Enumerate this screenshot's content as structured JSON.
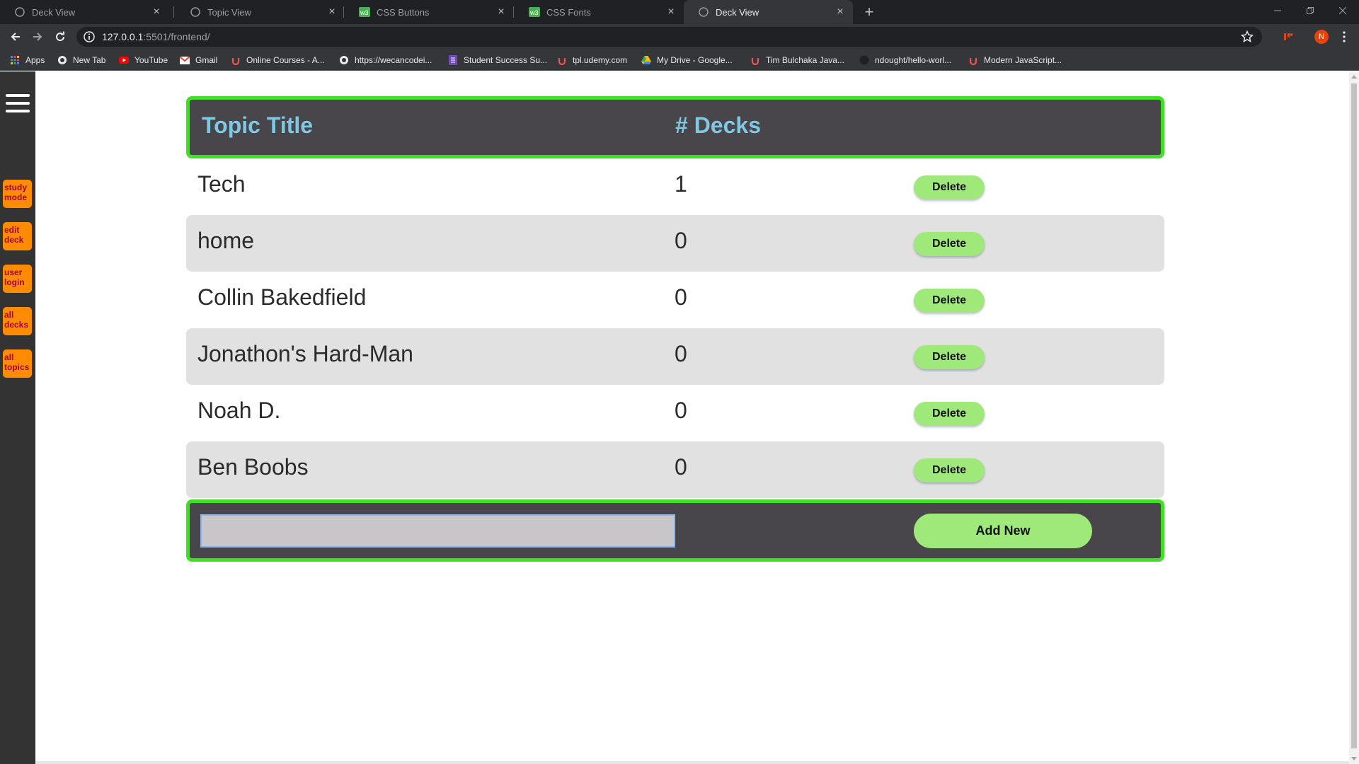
{
  "browser": {
    "tabs": [
      {
        "title": "Deck View",
        "icon": "globe-icon",
        "active": false
      },
      {
        "title": "Topic View",
        "icon": "globe-icon",
        "active": false
      },
      {
        "title": "CSS Buttons",
        "icon": "w3schools-icon",
        "active": false
      },
      {
        "title": "CSS Fonts",
        "icon": "w3schools-icon",
        "active": false
      },
      {
        "title": "Deck View",
        "icon": "globe-icon",
        "active": true
      }
    ],
    "url_host": "127.0.0.1",
    "url_rest": ":5501/frontend/",
    "profile_initial": "N",
    "bookmarks": [
      {
        "label": "Apps",
        "icon": "apps-grid-icon"
      },
      {
        "label": "New Tab",
        "icon": "globe-icon"
      },
      {
        "label": "YouTube",
        "icon": "youtube-icon"
      },
      {
        "label": "Gmail",
        "icon": "gmail-icon"
      },
      {
        "label": "Online Courses - A...",
        "icon": "udemy-icon"
      },
      {
        "label": "https://wecancodei...",
        "icon": "globe-icon"
      },
      {
        "label": "Student Success Su...",
        "icon": "forms-icon"
      },
      {
        "label": "tpl.udemy.com",
        "icon": "udemy-icon"
      },
      {
        "label": "My Drive - Google...",
        "icon": "google-drive-icon"
      },
      {
        "label": "Tim Bulchaka Java...",
        "icon": "udemy-icon"
      },
      {
        "label": "ndought/hello-worl...",
        "icon": "github-icon"
      },
      {
        "label": "Modern JavaScript...",
        "icon": "udemy-icon"
      }
    ]
  },
  "sidebar": {
    "buttons": [
      {
        "line1": "study",
        "line2": "mode"
      },
      {
        "line1": "edit",
        "line2": "deck"
      },
      {
        "line1": "user",
        "line2": "login"
      },
      {
        "line1": "all",
        "line2": "decks"
      },
      {
        "line1": "all",
        "line2": "topics"
      }
    ]
  },
  "table": {
    "headers": {
      "title": "Topic Title",
      "decks": "# Decks"
    },
    "rows": [
      {
        "title": "Tech",
        "decks": "1",
        "action": "Delete"
      },
      {
        "title": "home",
        "decks": "0",
        "action": "Delete"
      },
      {
        "title": "Collin Bakedfield",
        "decks": "0",
        "action": "Delete"
      },
      {
        "title": "Jonathon's Hard-Man",
        "decks": "0",
        "action": "Delete"
      },
      {
        "title": "Noah D.",
        "decks": "0",
        "action": "Delete"
      },
      {
        "title": "Ben Boobs",
        "decks": "0",
        "action": "Delete"
      }
    ],
    "add_input_value": "",
    "add_button": "Add New"
  },
  "colors": {
    "header_bg": "#48464a",
    "header_border": "#3fe023",
    "header_text": "#7ec8e3",
    "button_green": "#9fe87a",
    "sidebar_button": "#ff8c00"
  }
}
